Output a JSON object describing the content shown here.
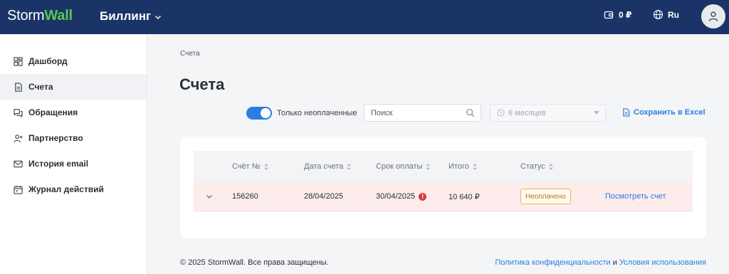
{
  "header": {
    "logo_storm": "Storm",
    "logo_wall": "Wall",
    "product": "Биллинг",
    "balance": "0 ₽",
    "language": "Ru"
  },
  "sidebar": {
    "items": [
      {
        "label": "Дашборд",
        "icon": "dashboard-icon"
      },
      {
        "label": "Счета",
        "icon": "document-icon",
        "active": true
      },
      {
        "label": "Обращения",
        "icon": "chat-icon"
      },
      {
        "label": "Партнерство",
        "icon": "partner-icon"
      },
      {
        "label": "История email",
        "icon": "mail-icon"
      },
      {
        "label": "Журнал действий",
        "icon": "calendar-icon"
      }
    ]
  },
  "main": {
    "breadcrumb": "Счета",
    "title": "Счета",
    "filters": {
      "unpaid_only_label": "Только неоплаченные",
      "unpaid_only_on": true,
      "search_placeholder": "Поиск",
      "period": "6 месяцев",
      "export_label": "Сохранить в Excel"
    },
    "table": {
      "columns": [
        "Счёт №",
        "Дата счета",
        "Срок оплаты",
        "Итого",
        "Статус"
      ],
      "rows": [
        {
          "number": "156260",
          "date": "28/04/2025",
          "due": "30/04/2025",
          "total": "10 640 ₽",
          "status": "Неоплачено",
          "action": "Посмотреть счет"
        }
      ]
    }
  },
  "footer": {
    "copyright": "© 2025 StormWall. Все права защищены.",
    "privacy": "Политика конфиденциальности",
    "and": "и",
    "terms": "Условия использования"
  },
  "colors": {
    "header_bg": "#1b3468",
    "accent": "#2a7de1",
    "logo_green": "#58c84d",
    "overdue_row": "#fcecec",
    "status_border": "#e8b84a"
  }
}
